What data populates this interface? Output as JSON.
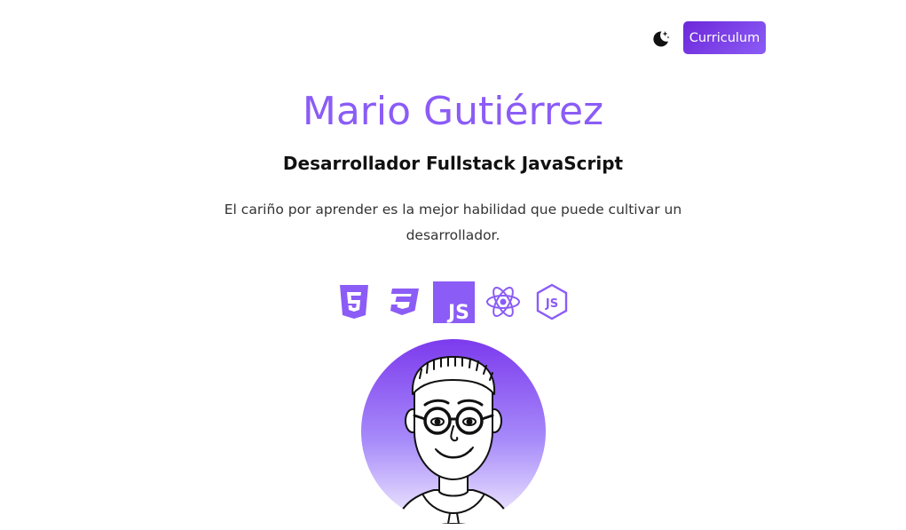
{
  "header": {
    "theme_icon": "moon-stars-icon",
    "cv_label": "Curriculum"
  },
  "hero": {
    "name": "Mario Gutiérrez",
    "role": "Desarrollador Fullstack JavaScript",
    "tagline": "El cariño por aprender es la mejor habilidad que puede cultivar un desarrollador."
  },
  "tech": [
    {
      "icon": "html5-icon"
    },
    {
      "icon": "css3-icon"
    },
    {
      "icon": "javascript-icon",
      "text": "JS"
    },
    {
      "icon": "react-icon"
    },
    {
      "icon": "nodejs-icon",
      "text": "JS"
    }
  ],
  "colors": {
    "accent": "#8b5cf6",
    "accent_dark": "#6d28d9",
    "avatar_top": "#7c3aed",
    "avatar_bottom": "#f3eefe"
  }
}
